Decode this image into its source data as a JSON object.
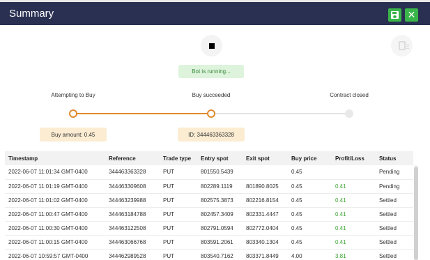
{
  "header": {
    "title": "Summary",
    "save_icon": "save-icon",
    "close_symbol": "✕"
  },
  "status": {
    "running_text": "Bot is running..."
  },
  "steps": [
    {
      "label": "Attempting to Buy",
      "info": "Buy amount: 0.45"
    },
    {
      "label": "Buy succeeded",
      "info": "ID: 344463363328"
    },
    {
      "label": "Contract closed"
    }
  ],
  "colors": {
    "header_bg": "#2a3052",
    "accent_green": "#39b54a",
    "progress_orange": "#e08a2d",
    "profit_green": "#3aa530"
  },
  "table": {
    "columns": [
      "Timestamp",
      "Reference",
      "Trade type",
      "Entry spot",
      "Exit spot",
      "Buy price",
      "Profit/Loss",
      "Status"
    ],
    "rows": [
      [
        "2022-06-07 11:01:34 GMT-0400",
        "344463363328",
        "PUT",
        "801550.5439",
        "",
        "0.45",
        "",
        "Pending"
      ],
      [
        "2022-06-07 11:01:19 GMT-0400",
        "344463309608",
        "PUT",
        "802289.1119",
        "801890.8025",
        "0.45",
        "0.41",
        "Pending"
      ],
      [
        "2022-06-07 11:01:02 GMT-0400",
        "344463239988",
        "PUT",
        "802575.3873",
        "802216.8154",
        "0.45",
        "0.41",
        "Settled"
      ],
      [
        "2022-06-07 11:00:47 GMT-0400",
        "344463184788",
        "PUT",
        "802457.3409",
        "802331.4447",
        "0.45",
        "0.41",
        "Settled"
      ],
      [
        "2022-06-07 11:00:30 GMT-0400",
        "344463122508",
        "PUT",
        "802791.0594",
        "802772.0404",
        "0.45",
        "0.41",
        "Settled"
      ],
      [
        "2022-06-07 11:00:15 GMT-0400",
        "344463066768",
        "PUT",
        "803591.2061",
        "803340.1304",
        "0.45",
        "0.41",
        "Settled"
      ],
      [
        "2022-06-07 10:59:57 GMT-0400",
        "344462989528",
        "PUT",
        "803540.7162",
        "803371.8449",
        "4.00",
        "3.81",
        "Settled"
      ]
    ]
  }
}
